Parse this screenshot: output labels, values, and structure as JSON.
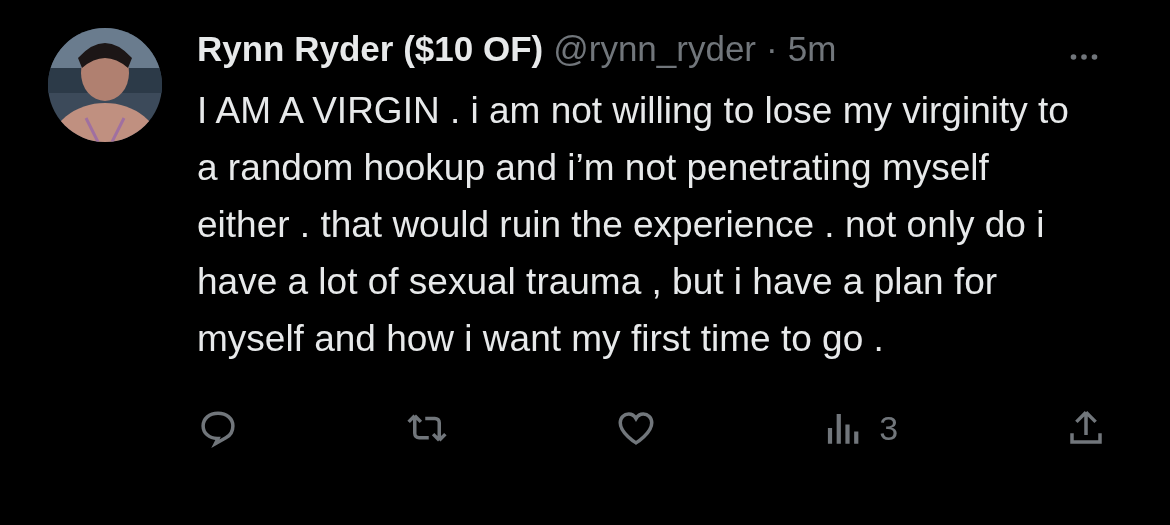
{
  "post": {
    "author_name": "Rynn Ryder ($10 OF)",
    "handle": "@rynn_ryder",
    "separator": "·",
    "time": "5m",
    "text": "I AM A VIRGIN . i am not willing to lose my virginity to a random hookup and i’m not penetrating myself either . that would ruin the experience . not only do i have a lot of sexual trauma , but i have a plan for myself and how i want my first time to go .",
    "views": "3"
  }
}
